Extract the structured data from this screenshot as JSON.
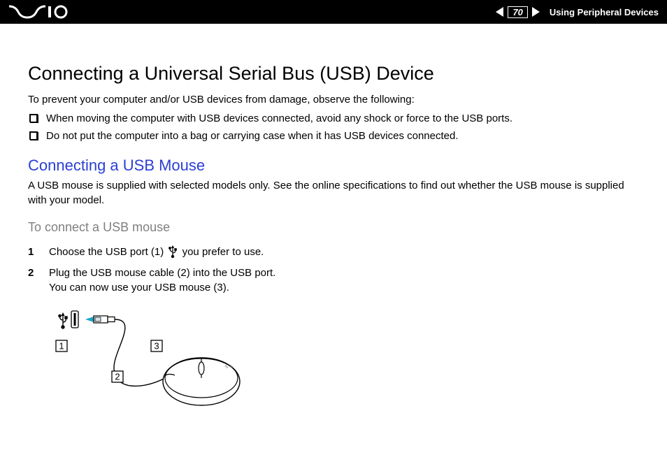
{
  "header": {
    "page_number": "70",
    "section_title": "Using Peripheral Devices"
  },
  "main": {
    "title": "Connecting a Universal Serial Bus (USB) Device",
    "intro": "To prevent your computer and/or USB devices from damage, observe the following:",
    "cautions": [
      "When moving the computer with USB devices connected, avoid any shock or force to the USB ports.",
      "Do not put the computer into a bag or carrying case when it has USB devices connected."
    ],
    "sub_title": "Connecting a USB Mouse",
    "sub_intro": "A USB mouse is supplied with selected models only. See the online specifications to find out whether the USB mouse is supplied with your model.",
    "procedure_title": "To connect a USB mouse",
    "steps": {
      "s1_a": "Choose the USB port (1) ",
      "s1_b": " you prefer to use.",
      "s2_a": "Plug the USB mouse cable (2) into the USB port.",
      "s2_b": "You can now use your USB mouse (3)."
    },
    "diagram_labels": {
      "l1": "1",
      "l2": "2",
      "l3": "3"
    }
  }
}
